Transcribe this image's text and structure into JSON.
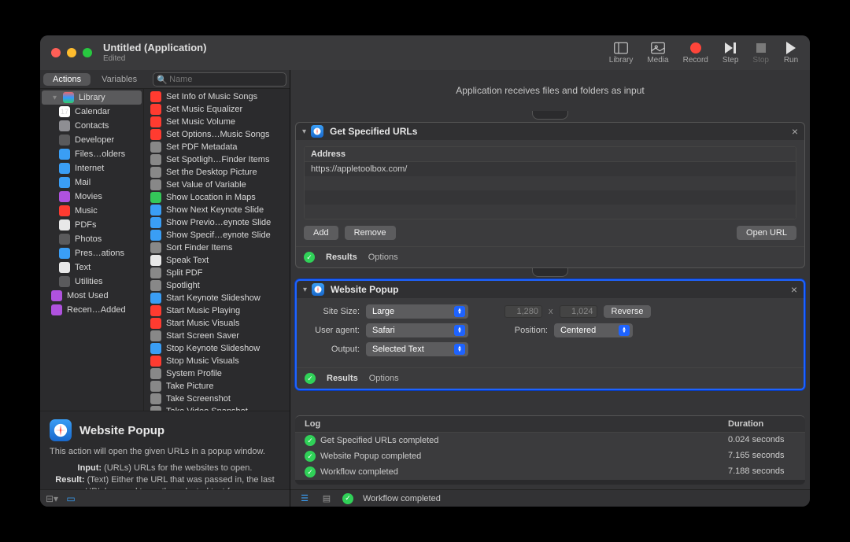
{
  "window": {
    "title": "Untitled (Application)",
    "subtitle": "Edited"
  },
  "toolbar": {
    "library": "Library",
    "media": "Media",
    "record": "Record",
    "step": "Step",
    "stop": "Stop",
    "run": "Run"
  },
  "tabs": {
    "actions": "Actions",
    "variables": "Variables",
    "search_placeholder": "Name"
  },
  "sidebar": {
    "library": "Library",
    "items": [
      {
        "label": "Calendar",
        "color": "#fff",
        "txt": "17"
      },
      {
        "label": "Contacts",
        "color": "#8e8e93"
      },
      {
        "label": "Developer",
        "color": "#5a5a5c"
      },
      {
        "label": "Files…olders",
        "color": "#3a9ef5"
      },
      {
        "label": "Internet",
        "color": "#3a9ef5"
      },
      {
        "label": "Mail",
        "color": "#3a9ef5"
      },
      {
        "label": "Movies",
        "color": "#af52de"
      },
      {
        "label": "Music",
        "color": "#ff3b30"
      },
      {
        "label": "PDFs",
        "color": "#e8e8e8"
      },
      {
        "label": "Photos",
        "color": "#5a5a5c"
      },
      {
        "label": "Pres…ations",
        "color": "#3a9ef5"
      },
      {
        "label": "Text",
        "color": "#e8e8e8"
      },
      {
        "label": "Utilities",
        "color": "#5a5a5c"
      }
    ],
    "most_used": "Most Used",
    "recently_added": "Recen…Added"
  },
  "actions_list": [
    {
      "label": "Set Info of Music Songs",
      "color": "#ff3b30"
    },
    {
      "label": "Set Music Equalizer",
      "color": "#ff3b30"
    },
    {
      "label": "Set Music Volume",
      "color": "#ff3b30"
    },
    {
      "label": "Set Options…Music Songs",
      "color": "#ff3b30"
    },
    {
      "label": "Set PDF Metadata",
      "color": "#888"
    },
    {
      "label": "Set Spotligh…Finder Items",
      "color": "#888"
    },
    {
      "label": "Set the Desktop Picture",
      "color": "#888"
    },
    {
      "label": "Set Value of Variable",
      "color": "#888"
    },
    {
      "label": "Show Location in Maps",
      "color": "#34c759"
    },
    {
      "label": "Show Next Keynote Slide",
      "color": "#3a9ef5"
    },
    {
      "label": "Show Previo…eynote Slide",
      "color": "#3a9ef5"
    },
    {
      "label": "Show Specif…eynote Slide",
      "color": "#3a9ef5"
    },
    {
      "label": "Sort Finder Items",
      "color": "#888"
    },
    {
      "label": "Speak Text",
      "color": "#e8e8e8"
    },
    {
      "label": "Split PDF",
      "color": "#888"
    },
    {
      "label": "Spotlight",
      "color": "#888"
    },
    {
      "label": "Start Keynote Slideshow",
      "color": "#3a9ef5"
    },
    {
      "label": "Start Music Playing",
      "color": "#ff3b30"
    },
    {
      "label": "Start Music Visuals",
      "color": "#ff3b30"
    },
    {
      "label": "Start Screen Saver",
      "color": "#888"
    },
    {
      "label": "Stop Keynote Slideshow",
      "color": "#3a9ef5"
    },
    {
      "label": "Stop Music Visuals",
      "color": "#ff3b30"
    },
    {
      "label": "System Profile",
      "color": "#888"
    },
    {
      "label": "Take Picture",
      "color": "#888"
    },
    {
      "label": "Take Screenshot",
      "color": "#888"
    },
    {
      "label": "Take Video Snapshot",
      "color": "#888"
    }
  ],
  "info": {
    "title": "Website Popup",
    "desc": "This action will open the given URLs in a popup window.",
    "input_label": "Input:",
    "input": "(URLs) URLs for the websites to open.",
    "result_label": "Result:",
    "result": "(Text) Either the URL that was passed in, the last URL browsed to, or the selected text from"
  },
  "header_message": "Application receives files and folders as input",
  "action1": {
    "title": "Get Specified URLs",
    "address_header": "Address",
    "url": "https://appletoolbox.com/",
    "add": "Add",
    "remove": "Remove",
    "open": "Open URL",
    "results": "Results",
    "options": "Options"
  },
  "action2": {
    "title": "Website Popup",
    "site_size_label": "Site Size:",
    "site_size": "Large",
    "user_agent_label": "User agent:",
    "user_agent": "Safari",
    "output_label": "Output:",
    "output": "Selected Text",
    "width": "1,280",
    "height": "1,024",
    "x": "x",
    "reverse": "Reverse",
    "position_label": "Position:",
    "position": "Centered",
    "results": "Results",
    "options": "Options"
  },
  "log": {
    "col1": "Log",
    "col2": "Duration",
    "rows": [
      {
        "msg": "Get Specified URLs completed",
        "dur": "0.024 seconds"
      },
      {
        "msg": "Website Popup completed",
        "dur": "7.165 seconds"
      },
      {
        "msg": "Workflow completed",
        "dur": "7.188 seconds"
      }
    ]
  },
  "status": "Workflow completed"
}
